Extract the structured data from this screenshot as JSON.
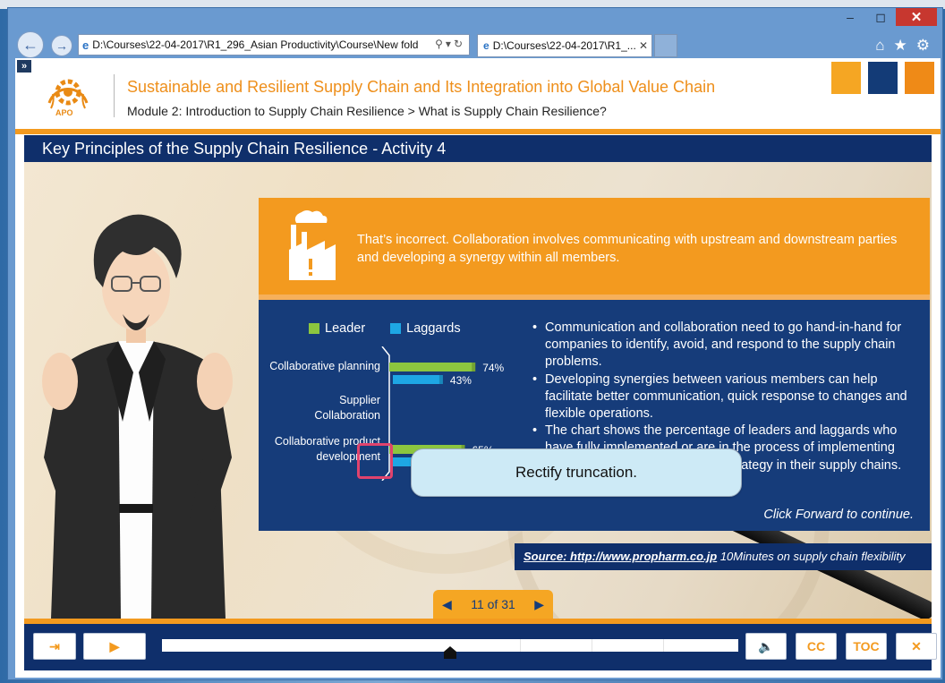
{
  "browser": {
    "address": "D:\\Courses\\22-04-2017\\R1_296_Asian Productivity\\Course\\New fold",
    "tab_title": "D:\\Courses\\22-04-2017\\R1_...",
    "window_controls": [
      "minimize",
      "maximize",
      "close"
    ]
  },
  "header": {
    "logo_text": "APO",
    "course_title": "Sustainable and Resilient Supply Chain and Its Integration into Global Value Chain",
    "breadcrumb": "Module 2: Introduction to Supply Chain Resilience > What is Supply Chain Resilience?",
    "accent_colors": [
      "#f5a623",
      "#133b77",
      "#ef8a17"
    ]
  },
  "slide": {
    "title": "Key Principles of the Supply Chain Resilience - Activity 4",
    "feedback": "That’s incorrect. Collaboration involves communicating with upstream and downstream parties and developing a synergy within all members.",
    "bullets": [
      "Communication and collaboration need to go hand-in-hand for companies to identify, avoid, and respond to the supply chain problems.",
      "Developing synergies between various members can help facilitate better communication, quick response to changes and flexible operations.",
      "The chart shows the percentage of leaders and laggards who have fully implemented or are in the process of implementing key elements of a collaborative strategy in their supply chains."
    ],
    "continue_text": "Click Forward to continue.",
    "source_link": "Source: http://www.propharm.co.jp",
    "source_desc": "10Minutes on supply chain flexibility"
  },
  "chart_data": {
    "type": "bar",
    "orientation": "horizontal",
    "categories": [
      "Collaborative planning",
      "Supplier Collaboration",
      "Collaborative product development"
    ],
    "series": [
      {
        "name": "Leader",
        "color": "#8cc63f",
        "values": [
          74,
          null,
          65
        ]
      },
      {
        "name": "Laggards",
        "color": "#1ea7e4",
        "values": [
          43,
          null,
          45
        ]
      }
    ],
    "value_labels": {
      "Leader": [
        "74%",
        "",
        "65%"
      ],
      "Laggards": [
        "43%",
        "",
        "45%"
      ]
    },
    "xlim": [
      0,
      100
    ],
    "legend_position": "top"
  },
  "callout": {
    "text": "Rectify truncation."
  },
  "pager": {
    "text": "11 of 31",
    "current": 11,
    "total": 31
  },
  "player": {
    "progress_fraction": 0.5,
    "buttons": [
      "exit",
      "play",
      "volume",
      "cc",
      "toc",
      "close"
    ],
    "cc_label": "CC",
    "toc_label": "TOC"
  }
}
